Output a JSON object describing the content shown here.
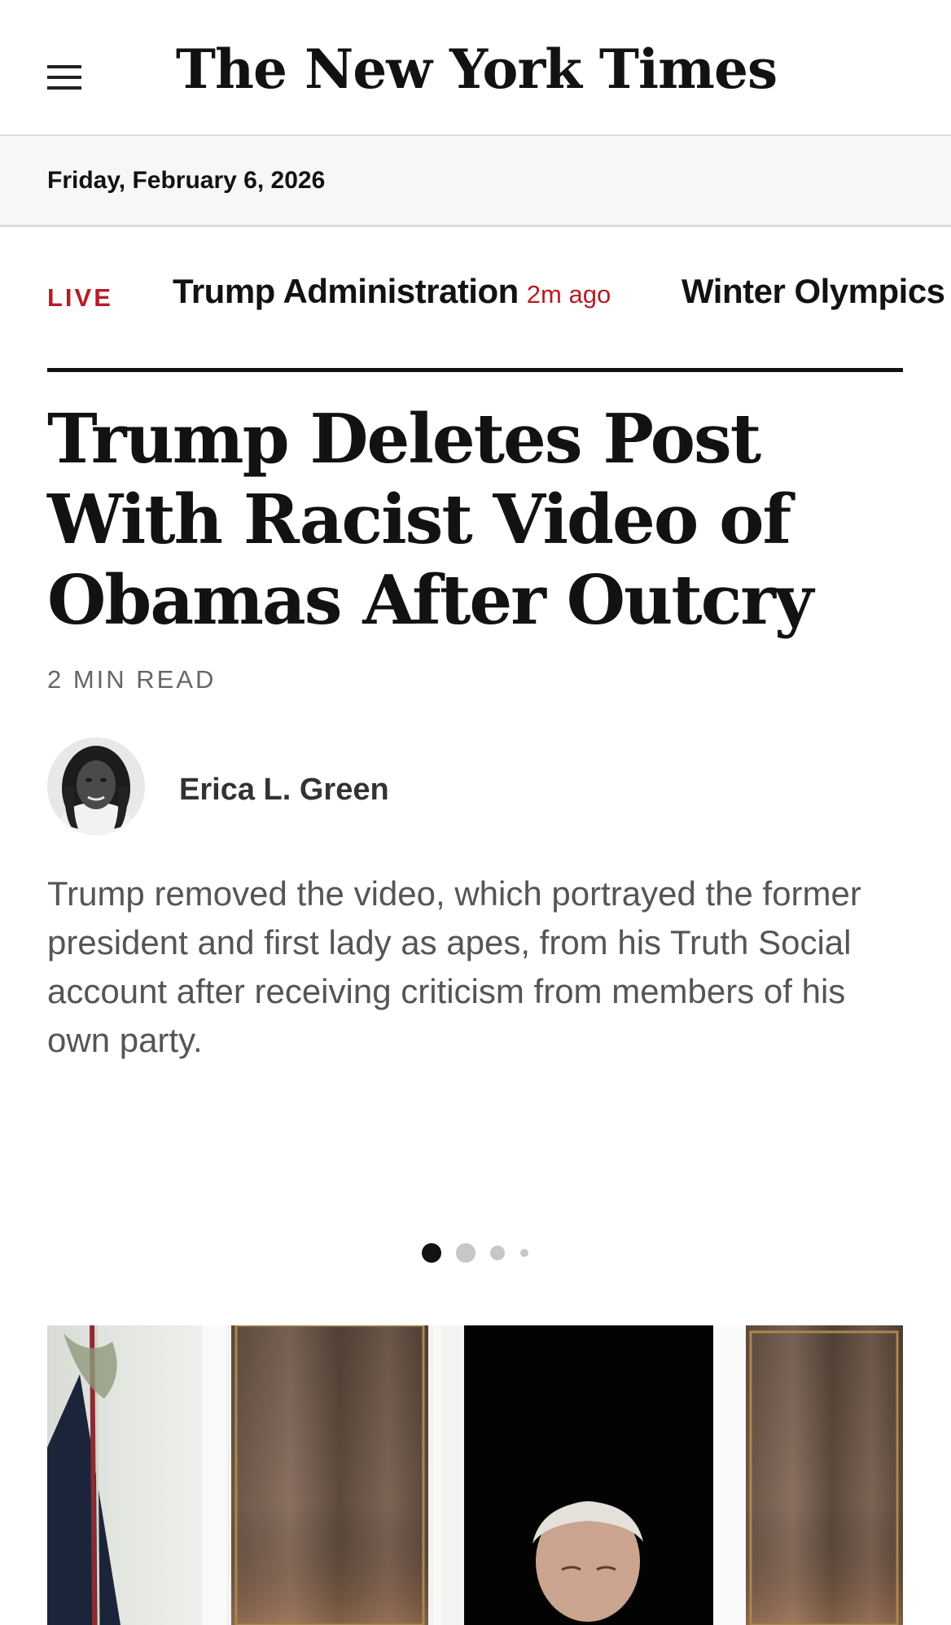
{
  "header": {
    "logo": "The New York Times",
    "menu_icon": "hamburger-menu-icon"
  },
  "date": "Friday, February 6, 2026",
  "ticker": {
    "live_label": "LIVE",
    "items": [
      {
        "label": "Trump Administration",
        "time": "2m ago"
      },
      {
        "label": "Winter Olympics"
      }
    ]
  },
  "article": {
    "headline": "Trump Deletes Post With Racist Video of Obamas After Outcry",
    "read_time": "2 MIN READ",
    "author": "Erica L. Green",
    "summary": "Trump removed the video, which portrayed the former president and first lady as apes, from his Truth Social account after receiving criticism from members of his own party."
  },
  "carousel": {
    "dot_count": 4,
    "active_index": 0
  },
  "colors": {
    "accent_red": "#b51d23",
    "text": "#121212",
    "summary_text": "#555555",
    "datebar_bg": "#f7f7f7"
  }
}
